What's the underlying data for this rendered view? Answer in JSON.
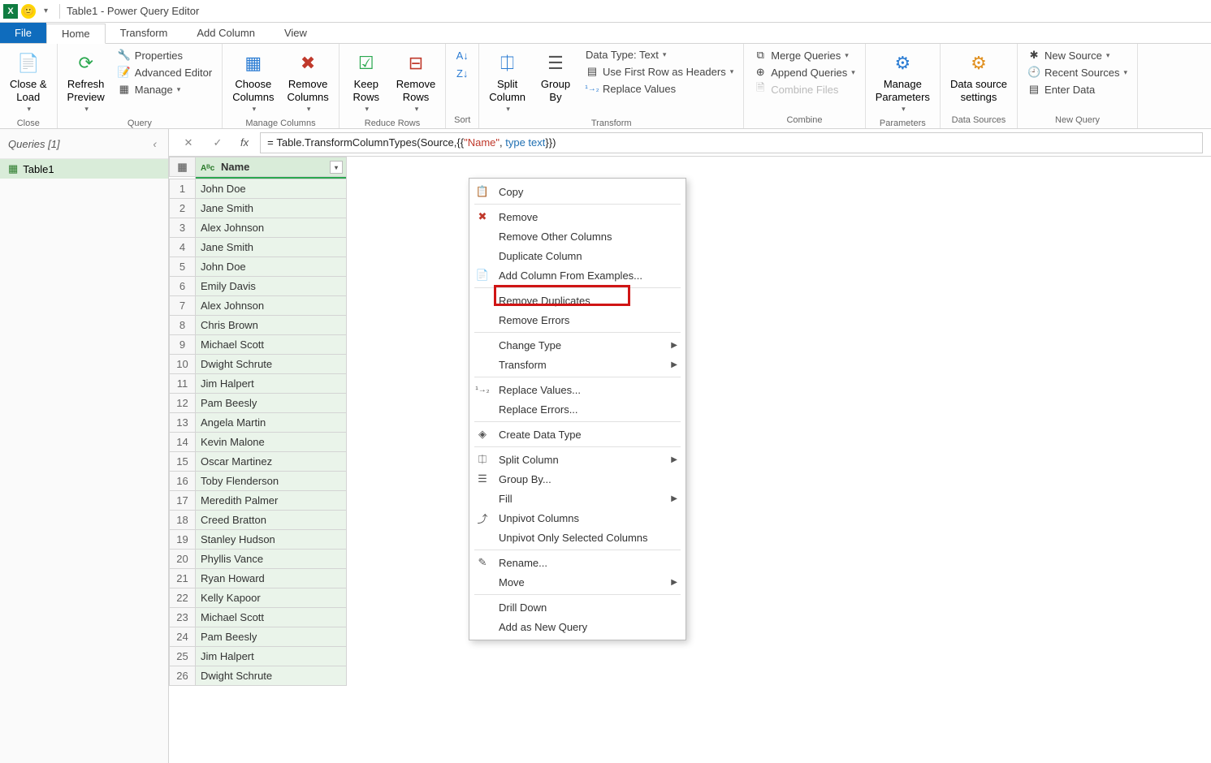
{
  "title": "Table1 - Power Query Editor",
  "tabs": {
    "file": "File",
    "home": "Home",
    "transform": "Transform",
    "add_column": "Add Column",
    "view": "View"
  },
  "ribbon": {
    "close": {
      "close_load": "Close &\nLoad",
      "group": "Close"
    },
    "query": {
      "refresh": "Refresh\nPreview",
      "properties": "Properties",
      "advanced": "Advanced Editor",
      "manage": "Manage",
      "group": "Query"
    },
    "manage_cols": {
      "choose": "Choose\nColumns",
      "remove": "Remove\nColumns",
      "group": "Manage Columns"
    },
    "reduce": {
      "keep": "Keep\nRows",
      "remove": "Remove\nRows",
      "group": "Reduce Rows"
    },
    "sort": {
      "group": "Sort"
    },
    "transform": {
      "split": "Split\nColumn",
      "group_by": "Group\nBy",
      "datatype": "Data Type: Text",
      "first_row": "Use First Row as Headers",
      "replace": "Replace Values",
      "group": "Transform"
    },
    "combine": {
      "merge": "Merge Queries",
      "append": "Append Queries",
      "combine_files": "Combine Files",
      "group": "Combine"
    },
    "parameters": {
      "manage": "Manage\nParameters",
      "group": "Parameters"
    },
    "datasources": {
      "settings": "Data source\nsettings",
      "group": "Data Sources"
    },
    "newquery": {
      "new_source": "New Source",
      "recent": "Recent Sources",
      "enter": "Enter Data",
      "group": "New Query"
    }
  },
  "queries_pane": {
    "header": "Queries [1]",
    "items": [
      "Table1"
    ]
  },
  "formula": {
    "prefix": "= ",
    "fn": "Table.TransformColumnTypes",
    "open": "(Source,{{",
    "str": "\"Name\"",
    "sep": ", ",
    "kw": "type text",
    "close": "}})"
  },
  "column": {
    "name": "Name"
  },
  "rows": [
    "John Doe",
    "Jane Smith",
    "Alex Johnson",
    "Jane Smith",
    "John Doe",
    "Emily Davis",
    "Alex Johnson",
    "Chris Brown",
    "Michael Scott",
    "Dwight Schrute",
    "Jim Halpert",
    "Pam Beesly",
    "Angela Martin",
    "Kevin Malone",
    "Oscar Martinez",
    "Toby Flenderson",
    "Meredith Palmer",
    "Creed Bratton",
    "Stanley Hudson",
    "Phyllis Vance",
    "Ryan Howard",
    "Kelly Kapoor",
    "Michael Scott",
    "Pam Beesly",
    "Jim Halpert",
    "Dwight Schrute"
  ],
  "context_menu": {
    "copy": "Copy",
    "remove": "Remove",
    "remove_other": "Remove Other Columns",
    "duplicate": "Duplicate Column",
    "add_from_examples": "Add Column From Examples...",
    "remove_duplicates": "Remove Duplicates",
    "remove_errors": "Remove Errors",
    "change_type": "Change Type",
    "transform": "Transform",
    "replace_values": "Replace Values...",
    "replace_errors": "Replace Errors...",
    "create_data_type": "Create Data Type",
    "split_column": "Split Column",
    "group_by": "Group By...",
    "fill": "Fill",
    "unpivot": "Unpivot Columns",
    "unpivot_only": "Unpivot Only Selected Columns",
    "rename": "Rename...",
    "move": "Move",
    "drill": "Drill Down",
    "add_new_query": "Add as New Query"
  }
}
